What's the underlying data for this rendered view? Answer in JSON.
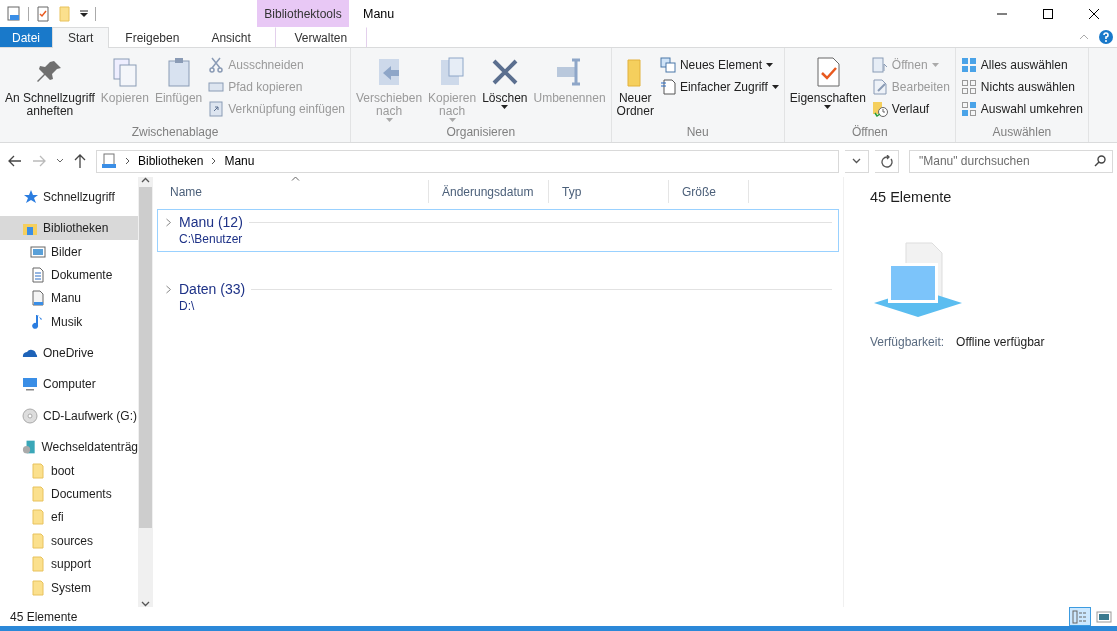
{
  "window": {
    "title": "Manu",
    "context_label": "Bibliothektools"
  },
  "tabs": [
    {
      "label": "Datei",
      "kind": "file",
      "selected": false
    },
    {
      "label": "Start",
      "kind": "normal",
      "selected": true
    },
    {
      "label": "Freigeben",
      "kind": "normal",
      "selected": false
    },
    {
      "label": "Ansicht",
      "kind": "normal",
      "selected": false
    },
    {
      "label": "Verwalten",
      "kind": "contextual",
      "selected": false
    }
  ],
  "ribbon": [
    {
      "name": "Zwischenablage",
      "items": [
        {
          "label": "An Schnellzugriff\nanheften",
          "kind": "large",
          "disabled": false,
          "dropdown": false
        },
        {
          "label": "Kopieren",
          "kind": "large",
          "disabled": true,
          "dropdown": false
        },
        {
          "label": "Einfügen",
          "kind": "large",
          "disabled": true,
          "dropdown": false
        },
        {
          "kind": "stack",
          "items": [
            {
              "label": "Ausschneiden",
              "disabled": true,
              "dropdown": false
            },
            {
              "label": "Pfad kopieren",
              "disabled": true,
              "dropdown": false
            },
            {
              "label": "Verknüpfung einfügen",
              "disabled": true,
              "dropdown": false
            }
          ]
        }
      ]
    },
    {
      "name": "Organisieren",
      "items": [
        {
          "label": "Verschieben\nnach",
          "kind": "large",
          "disabled": true,
          "dropdown": true
        },
        {
          "label": "Kopieren\nnach",
          "kind": "large",
          "disabled": true,
          "dropdown": true
        },
        {
          "label": "Löschen",
          "kind": "large",
          "disabled": false,
          "dropdown": true
        },
        {
          "label": "Umbenennen",
          "kind": "large",
          "disabled": true,
          "dropdown": false
        }
      ]
    },
    {
      "name": "Neu",
      "items": [
        {
          "label": "Neuer\nOrdner",
          "kind": "large",
          "disabled": false,
          "dropdown": false
        },
        {
          "kind": "stack",
          "items": [
            {
              "label": "Neues Element",
              "disabled": false,
              "dropdown": true
            },
            {
              "label": "Einfacher Zugriff",
              "disabled": false,
              "dropdown": true
            }
          ]
        }
      ]
    },
    {
      "name": "Öffnen",
      "items": [
        {
          "label": "Eigenschaften",
          "kind": "large",
          "disabled": false,
          "dropdown": true
        },
        {
          "kind": "stack",
          "items": [
            {
              "label": "Öffnen",
              "disabled": true,
              "dropdown": true
            },
            {
              "label": "Bearbeiten",
              "disabled": true,
              "dropdown": false
            },
            {
              "label": "Verlauf",
              "disabled": false,
              "dropdown": false
            }
          ]
        }
      ]
    },
    {
      "name": "Auswählen",
      "items": [
        {
          "kind": "stack",
          "items": [
            {
              "label": "Alles auswählen",
              "disabled": false,
              "dropdown": false
            },
            {
              "label": "Nichts auswählen",
              "disabled": false,
              "dropdown": false
            },
            {
              "label": "Auswahl umkehren",
              "disabled": false,
              "dropdown": false
            }
          ]
        }
      ]
    }
  ],
  "address": {
    "crumbs": [
      "Bibliotheken",
      "Manu"
    ],
    "search": {
      "placeholder": "\"Manu\" durchsuchen"
    }
  },
  "sidebar": {
    "items": [
      {
        "label": "Schnellzugriff",
        "selected": false
      },
      {
        "label": "Bibliotheken",
        "selected": true,
        "children": [
          {
            "label": "Bilder",
            "selected": false
          },
          {
            "label": "Dokumente",
            "selected": false
          },
          {
            "label": "Manu",
            "selected": false
          },
          {
            "label": "Musik",
            "selected": false
          }
        ]
      },
      {
        "label": "OneDrive",
        "selected": false
      },
      {
        "label": "Computer",
        "selected": false
      },
      {
        "label": "CD-Laufwerk (G:)",
        "selected": false
      },
      {
        "label": "Wechseldatenträg",
        "selected": false,
        "children": [
          {
            "label": "boot",
            "selected": false
          },
          {
            "label": "Documents",
            "selected": false
          },
          {
            "label": "efi",
            "selected": false
          },
          {
            "label": "sources",
            "selected": false
          },
          {
            "label": "support",
            "selected": false
          },
          {
            "label": "System",
            "selected": false
          }
        ]
      }
    ]
  },
  "table": {
    "columns": [
      {
        "label": "Name",
        "sorted": true
      },
      {
        "label": "Änderungsdatum",
        "sorted": false
      },
      {
        "label": "Typ",
        "sorted": false
      },
      {
        "label": "Größe",
        "sorted": false
      }
    ],
    "groups": [
      {
        "title": "Manu (12)",
        "path": "C:\\Benutzer",
        "selected": true,
        "expanded": false
      },
      {
        "title": "Daten (33)",
        "path": "D:\\",
        "selected": false,
        "expanded": false
      }
    ]
  },
  "details": {
    "title": "45 Elemente",
    "fields": [
      {
        "label": "Verfügbarkeit:",
        "value": "Offline verfügbar"
      }
    ]
  },
  "status_bar": {
    "text": "45 Elemente",
    "views": [
      {
        "kind": "details",
        "selected": true
      },
      {
        "kind": "tiles",
        "selected": false
      }
    ]
  }
}
